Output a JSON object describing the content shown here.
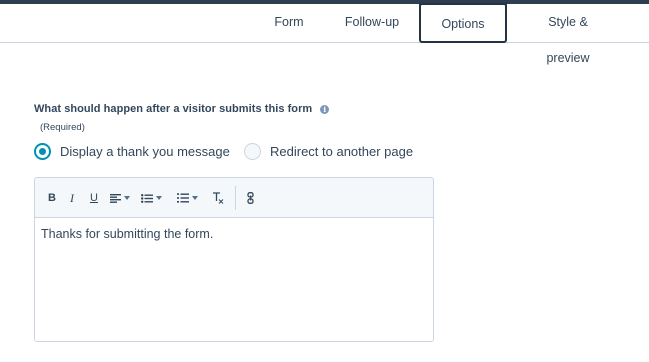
{
  "tabs": [
    {
      "label": "Form"
    },
    {
      "label": "Follow-up"
    },
    {
      "label": "Options",
      "active": true
    },
    {
      "label": "Style & preview"
    }
  ],
  "question": {
    "label": "What should happen after a visitor submits this form",
    "required_text": "(Required)",
    "info_icon": "info-icon"
  },
  "options": [
    {
      "label": "Display a thank you message",
      "selected": true
    },
    {
      "label": "Redirect to another page",
      "selected": false
    }
  ],
  "toolbar": {
    "bold": "B",
    "italic": "I",
    "underline": "U",
    "clear_format": "Tx"
  },
  "editor": {
    "content": "Thanks for submitting the form."
  },
  "colors": {
    "accent": "#0091ae",
    "text": "#33475b",
    "border": "#cbd6e2",
    "topbar": "#2d3e50"
  }
}
